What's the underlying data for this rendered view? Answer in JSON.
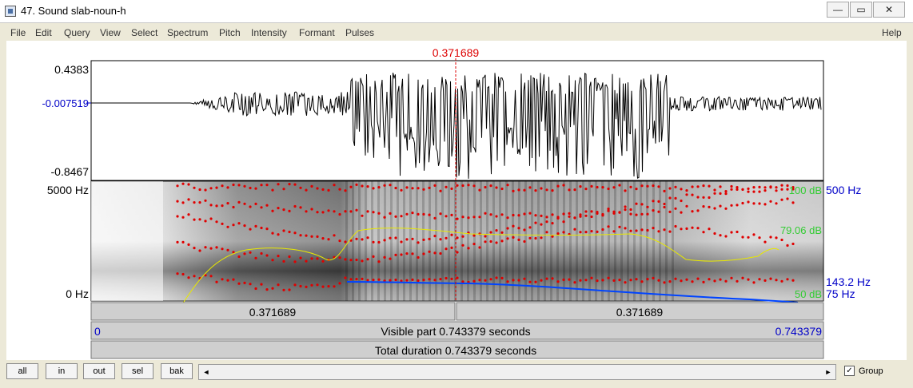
{
  "window": {
    "title": "47. Sound slab-noun-h",
    "controls": {
      "minimize": "—",
      "maximize": "▭",
      "close": "✕"
    }
  },
  "menu": {
    "items": [
      "File",
      "Edit",
      "Query",
      "View",
      "Select",
      "Spectrum",
      "Pitch",
      "Intensity",
      "Formant",
      "Pulses"
    ],
    "help": "Help"
  },
  "cursor": {
    "time": "0.371689"
  },
  "waveform": {
    "max": "0.4383",
    "center": "-0.007519",
    "min": "-0.8467"
  },
  "spectrogram": {
    "top_freq": "5000 Hz",
    "bottom_freq": "0 Hz",
    "intensity_top": "100 dB",
    "intensity_mid": "79.06 dB",
    "intensity_bottom": "50 dB",
    "pitch_top": "500 Hz",
    "pitch_value": "143.2 Hz",
    "pitch_bottom": "75 Hz"
  },
  "time_rows": {
    "left_segment": "0.371689",
    "right_segment": "0.371689",
    "visible_start": "0",
    "visible_label": "Visible part 0.743379 seconds",
    "visible_end": "0.743379",
    "total_label": "Total duration 0.743379 seconds"
  },
  "colors": {
    "cursor": "#dd0000",
    "axis_blue": "#0000c8",
    "intensity_green": "#33cc33",
    "formant": "#e00000",
    "pitch": "#0044ff",
    "intensity_curve": "#e8e800"
  },
  "bottom": {
    "buttons": [
      "all",
      "in",
      "out",
      "sel",
      "bak"
    ],
    "scroll_left": "◄",
    "scroll_right": "►",
    "group_check": "✓",
    "group_label": "Group"
  }
}
